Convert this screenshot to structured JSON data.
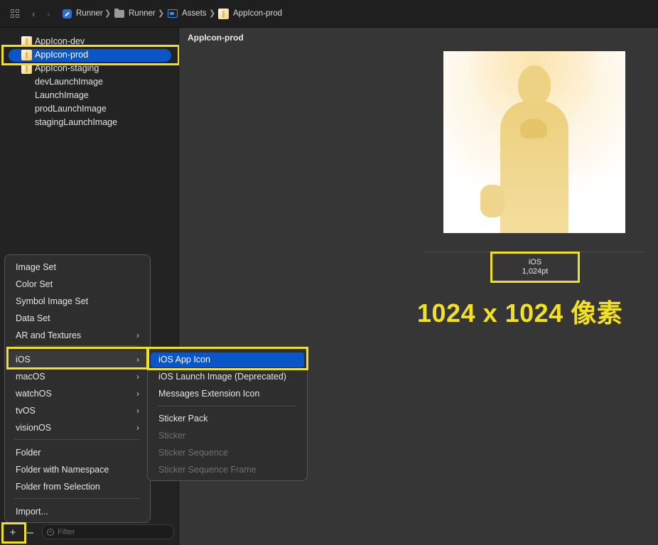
{
  "breadcrumb": {
    "items": [
      "Runner",
      "Runner",
      "Assets",
      "AppIcon-prod"
    ],
    "separator": "❯"
  },
  "sidebar": {
    "items": [
      {
        "label": "AppIcon-dev",
        "thumb": true
      },
      {
        "label": "AppIcon-prod",
        "thumb": true,
        "selected": true
      },
      {
        "label": "AppIcon-staging",
        "thumb": true
      },
      {
        "label": "devLaunchImage",
        "thumb": false
      },
      {
        "label": "LaunchImage",
        "thumb": false
      },
      {
        "label": "prodLaunchImage",
        "thumb": false
      },
      {
        "label": "stagingLaunchImage",
        "thumb": false
      }
    ]
  },
  "bottom_bar": {
    "add_label": "+",
    "filter_placeholder": "Filter"
  },
  "main": {
    "title": "AppIcon-prod",
    "slot_platform": "iOS",
    "slot_size": "1,024pt",
    "annotation": "1024 x 1024 像素"
  },
  "add_menu": {
    "items": [
      {
        "label": "Image Set",
        "submenu": false
      },
      {
        "label": "Color Set",
        "submenu": false
      },
      {
        "label": "Symbol Image Set",
        "submenu": false
      },
      {
        "label": "Data Set",
        "submenu": false
      },
      {
        "label": "AR and Textures",
        "submenu": true
      },
      {
        "label": "iOS",
        "submenu": true,
        "highlighted": true
      },
      {
        "label": "macOS",
        "submenu": true
      },
      {
        "label": "watchOS",
        "submenu": true
      },
      {
        "label": "tvOS",
        "submenu": true
      },
      {
        "label": "visionOS",
        "submenu": true
      },
      {
        "label": "Folder",
        "submenu": false
      },
      {
        "label": "Folder with Namespace",
        "submenu": false
      },
      {
        "label": "Folder from Selection",
        "submenu": false
      },
      {
        "label": "Import...",
        "submenu": false
      }
    ]
  },
  "ios_submenu": {
    "items": [
      {
        "label": "iOS App Icon",
        "selected": true,
        "enabled": true
      },
      {
        "label": "iOS Launch Image (Deprecated)",
        "enabled": true
      },
      {
        "label": "Messages Extension Icon",
        "enabled": true
      },
      {
        "label": "Sticker Pack",
        "enabled": true
      },
      {
        "label": "Sticker",
        "enabled": false
      },
      {
        "label": "Sticker Sequence",
        "enabled": false
      },
      {
        "label": "Sticker Sequence Frame",
        "enabled": false
      }
    ]
  },
  "colors": {
    "accent": "#0a55c8",
    "highlight_box": "#f3e11f"
  }
}
